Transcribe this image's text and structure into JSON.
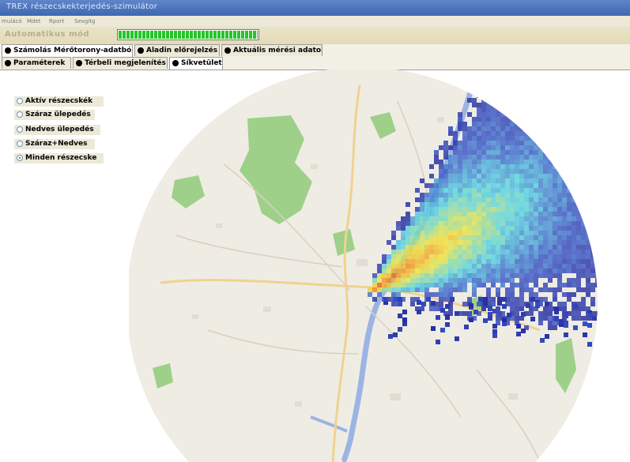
{
  "app": {
    "title": "TREX részecskekterjedés-szimulátor",
    "menu": [
      "mulácó",
      "Mdet",
      "Rport",
      "Sevgitg"
    ]
  },
  "status": {
    "mode_label": "Automatikus mód",
    "progress_fraction": 1.0
  },
  "tabs_primary": [
    {
      "label": "Számolás Mérőtorony-adatból",
      "active": true
    },
    {
      "label": "Aladin előrejelzés",
      "active": false
    },
    {
      "label": "Aktuális mérési adatok",
      "active": false
    }
  ],
  "tabs_secondary": [
    {
      "label": "Paraméterek",
      "active": false
    },
    {
      "label": "Térbeli megjelenítés",
      "active": false
    },
    {
      "label": "Síkvetület",
      "active": true
    }
  ],
  "particle_filter": {
    "options": [
      {
        "label": "Aktív részecskék",
        "selected": false
      },
      {
        "label": "Száraz ülepedés",
        "selected": false
      },
      {
        "label": "Nedves ülepedés",
        "selected": false
      },
      {
        "label": "Száraz+Nedves",
        "selected": false
      },
      {
        "label": "Minden részecske",
        "selected": true
      }
    ]
  },
  "colors": {
    "titlebar": "#4f77c0",
    "map_land": "#efece4",
    "forest": "#9ed08a",
    "water": "#9cb4e4",
    "road": "#f0d290",
    "plume_low": "#22249a",
    "plume_mid": "#56d4e2",
    "plume_high": "#f0e43c",
    "plume_peak": "#e03a20"
  }
}
